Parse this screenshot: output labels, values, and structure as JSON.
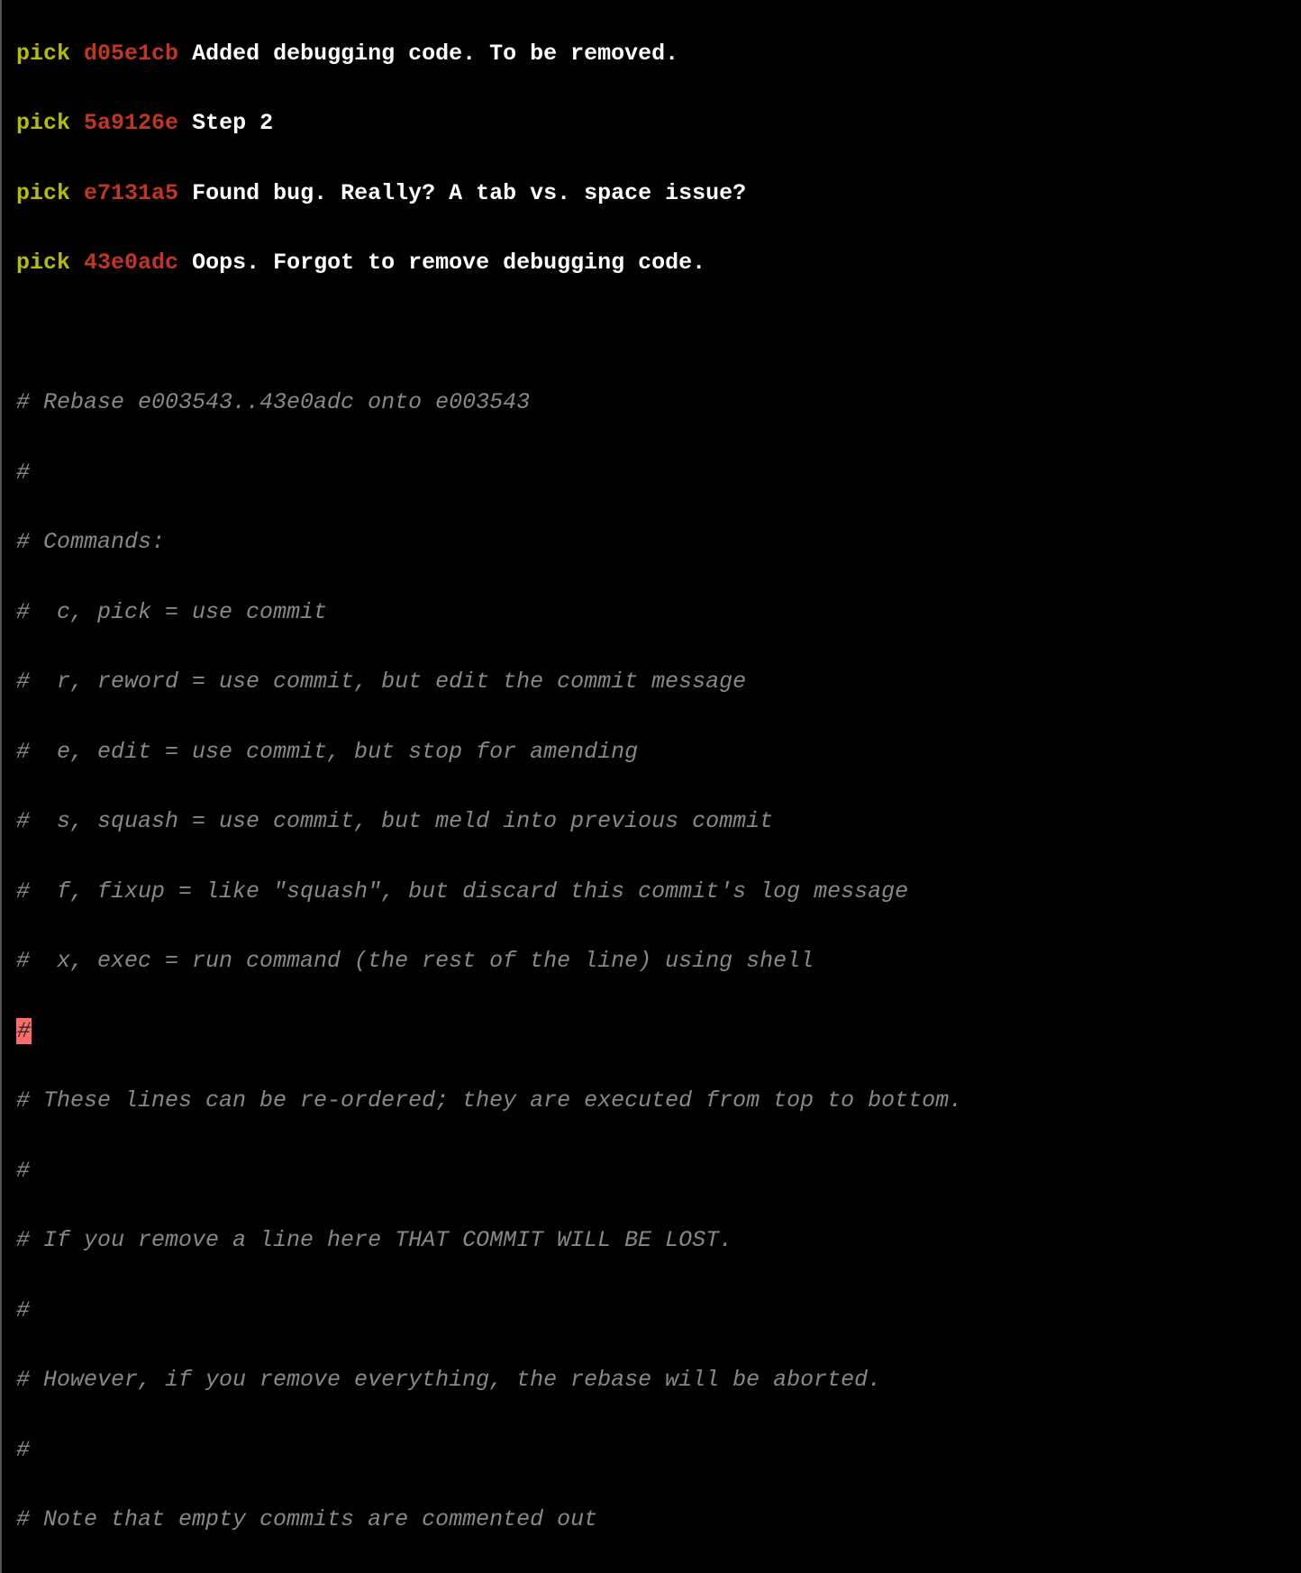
{
  "picks": [
    {
      "action": "pick",
      "hash": "d05e1cb",
      "message": "Added debugging code. To be removed."
    },
    {
      "action": "pick",
      "hash": "5a9126e",
      "message": "Step 2"
    },
    {
      "action": "pick",
      "hash": "e7131a5",
      "message": "Found bug. Really? A tab vs. space issue?"
    },
    {
      "action": "pick",
      "hash": "43e0adc",
      "message": "Oops. Forgot to remove debugging code."
    }
  ],
  "comments": {
    "l0": "",
    "l1": "# Rebase e003543..43e0adc onto e003543",
    "l2": "#",
    "l3": "# Commands:",
    "l4": "#  c, pick = use commit",
    "l5": "#  r, reword = use commit, but edit the commit message",
    "l6": "#  e, edit = use commit, but stop for amending",
    "l7": "#  s, squash = use commit, but meld into previous commit",
    "l8": "#  f, fixup = like \"squash\", but discard this commit's log message",
    "l9": "#  x, exec = run command (the rest of the line) using shell",
    "cursor": "#",
    "l10": "# These lines can be re-ordered; they are executed from top to bottom.",
    "l11": "#",
    "l12": "# If you remove a line here THAT COMMIT WILL BE LOST.",
    "l13": "#",
    "l14": "# However, if you remove everything, the rebase will be aborted.",
    "l15": "#",
    "l16": "# Note that empty commits are commented out"
  }
}
